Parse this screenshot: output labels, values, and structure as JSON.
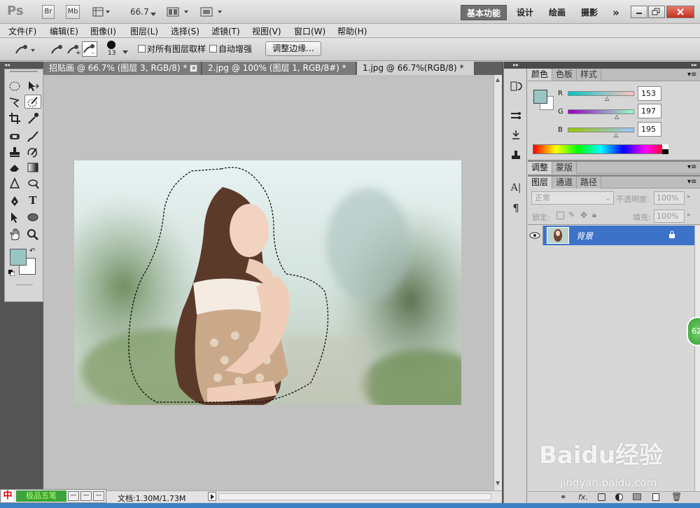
{
  "app": {
    "logo": "Ps",
    "bridge_btn": "Br",
    "minibridge_btn": "Mb",
    "zoom": "66.7",
    "workspaces": [
      "基本功能",
      "设计",
      "绘画",
      "摄影"
    ],
    "more": "»"
  },
  "menu": [
    "文件(F)",
    "编辑(E)",
    "图像(I)",
    "图层(L)",
    "选择(S)",
    "滤镜(T)",
    "视图(V)",
    "窗口(W)",
    "帮助(H)"
  ],
  "options": {
    "brush_size": "13",
    "sample_all_layers": "对所有图层取样",
    "auto_enhance": "自动增强",
    "refine_edge": "调整边缘..."
  },
  "tabs": [
    {
      "label": "招贴画 @ 66.7% (图层 3, RGB/8) *",
      "active": false
    },
    {
      "label": "2.jpg @ 100% (图层 1, RGB/8#) *",
      "active": false
    },
    {
      "label": "1.jpg @ 66.7%(RGB/8) *",
      "active": true
    }
  ],
  "status": {
    "doc": "文档:1.30M/1.73M"
  },
  "color_panel": {
    "tabs": [
      "颜色",
      "色板",
      "样式"
    ],
    "r_label": "R",
    "g_label": "G",
    "b_label": "B",
    "r": "153",
    "g": "197",
    "b": "195",
    "fg": "#99c5c3"
  },
  "adjust_panel": {
    "tabs": [
      "调整",
      "蒙版"
    ]
  },
  "layers_panel": {
    "tabs": [
      "图层",
      "通道",
      "路径"
    ],
    "blend_mode": "正常",
    "opacity_label": "不透明度:",
    "opacity": "100%",
    "lock_label": "锁定:",
    "fill_label": "填充:",
    "fill": "100%",
    "layer_name": "背景"
  },
  "taskbar": {
    "label": "极品五笔"
  },
  "badge": "62",
  "watermark": {
    "brand": "Baidu经验",
    "url": "jingyan.baidu.com"
  }
}
